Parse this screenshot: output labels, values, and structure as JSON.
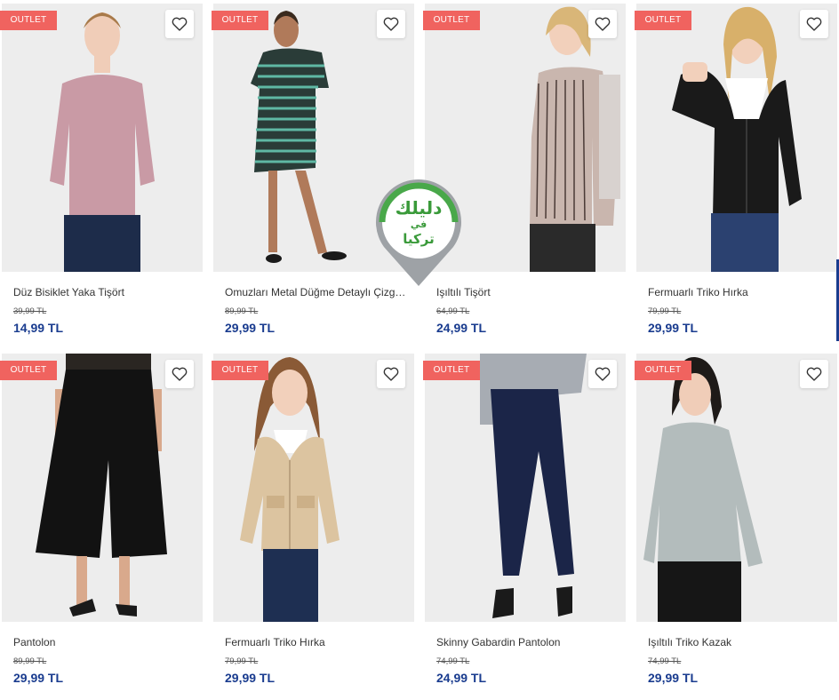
{
  "colors": {
    "badge": "#f0635f",
    "price": "#1a3c8f",
    "watermark_green": "#3a9a3a"
  },
  "badge_label": "OUTLET",
  "favorite_icon": "heart-outline-icon",
  "watermark": {
    "line1": "دليلك",
    "line2": "في",
    "line3": "تركيا"
  },
  "products": [
    {
      "name": "Düz Bisiklet Yaka Tişört",
      "old_price": "39,99 TL",
      "price": "14,99 TL"
    },
    {
      "name": "Omuzları Metal Düğme Detaylı Çizgil...",
      "old_price": "89,99 TL",
      "price": "29,99 TL"
    },
    {
      "name": "Işıltılı Tişört",
      "old_price": "64,99 TL",
      "price": "24,99 TL"
    },
    {
      "name": "Fermuarlı Triko Hırka",
      "old_price": "79,99 TL",
      "price": "29,99 TL"
    },
    {
      "name": "Pantolon",
      "old_price": "89,99 TL",
      "price": "29,99 TL"
    },
    {
      "name": "Fermuarlı Triko Hırka",
      "old_price": "79,99 TL",
      "price": "29,99 TL"
    },
    {
      "name": "Skinny Gabardin Pantolon",
      "old_price": "74,99 TL",
      "price": "24,99 TL"
    },
    {
      "name": "Işıltılı Triko Kazak",
      "old_price": "74,99 TL",
      "price": "29,99 TL"
    }
  ]
}
